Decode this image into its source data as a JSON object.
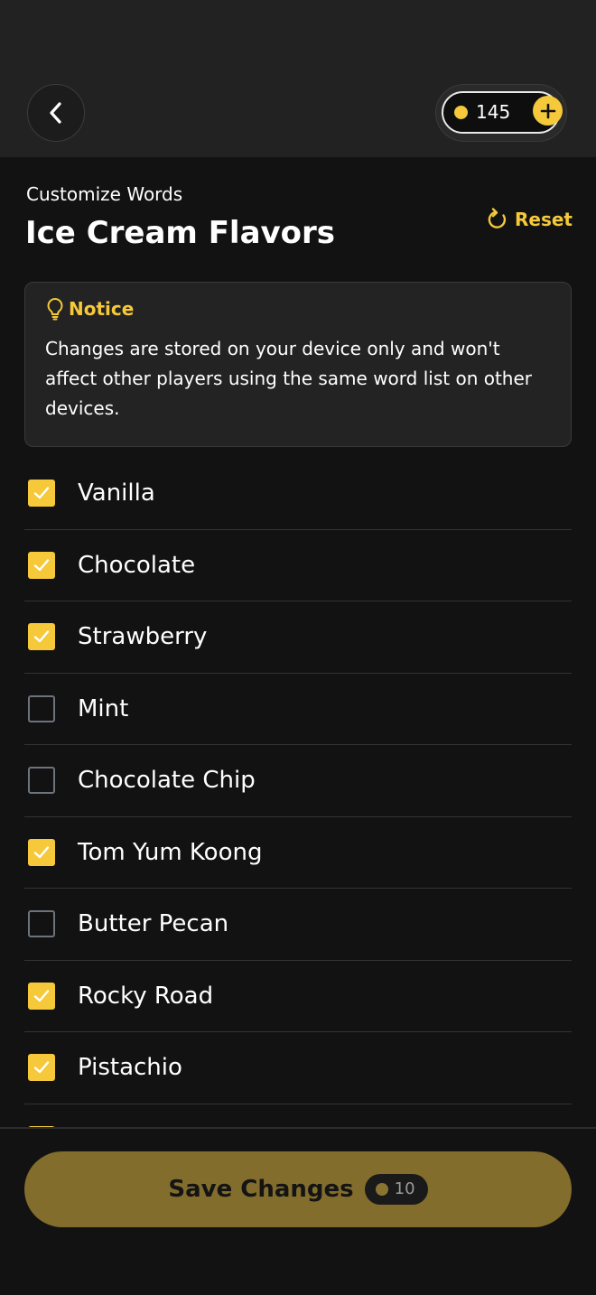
{
  "header": {
    "coins": "145"
  },
  "page": {
    "subtitle": "Customize Words",
    "title": "Ice Cream Flavors",
    "reset_label": "Reset"
  },
  "notice": {
    "title": "Notice",
    "body": "Changes are stored on your device only and won't affect other players using the same word list on other devices."
  },
  "words": [
    {
      "label": "Vanilla",
      "checked": true
    },
    {
      "label": "Chocolate",
      "checked": true
    },
    {
      "label": "Strawberry",
      "checked": true
    },
    {
      "label": "Mint",
      "checked": false
    },
    {
      "label": "Chocolate Chip",
      "checked": false
    },
    {
      "label": "Tom Yum Koong",
      "checked": true
    },
    {
      "label": "Butter Pecan",
      "checked": false
    },
    {
      "label": "Rocky Road",
      "checked": true
    },
    {
      "label": "Pistachio",
      "checked": true
    },
    {
      "label": "",
      "checked": true
    }
  ],
  "save": {
    "label": "Save Changes",
    "cost": "10"
  },
  "colors": {
    "accent": "#f5c93a",
    "background": "#121212",
    "save_button": "#826d2c"
  }
}
